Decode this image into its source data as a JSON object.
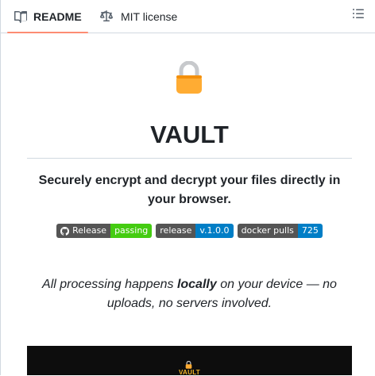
{
  "tabs": {
    "readme": "README",
    "license": "MIT license"
  },
  "readme": {
    "emoji": "lock",
    "title": "VAULT",
    "subtitle": "Securely encrypt and decrypt your files directly in your browser.",
    "badges": [
      {
        "left": "Release",
        "right": "passing",
        "color": "#44cc11"
      },
      {
        "left": "release",
        "right": "v.1.0.0",
        "color": "#007ec6"
      },
      {
        "left": "docker pulls",
        "right": "725",
        "color": "#007ec6"
      }
    ],
    "tagline": {
      "before": "All processing happens ",
      "emphasis": "locally",
      "after": " on your device — no uploads, no servers involved."
    },
    "preview": {
      "title": "VAULT"
    }
  }
}
